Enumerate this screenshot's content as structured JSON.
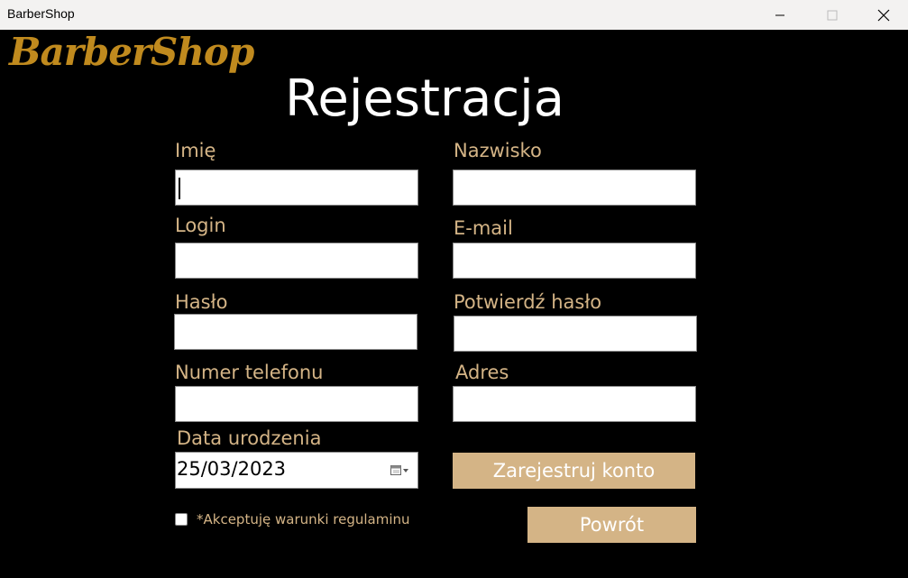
{
  "window": {
    "title": "BarberShop",
    "icons": {
      "minimize": "minimize-icon",
      "maximize": "maximize-icon",
      "close": "close-icon"
    }
  },
  "logo": "BarberShop",
  "page_title": "Rejestracja",
  "form": {
    "imie_label": "Imię",
    "nazwisko_label": "Nazwisko",
    "login_label": "Login",
    "email_label": "E-mail",
    "haslo_label": "Hasło",
    "potwierdz_label": "Potwierdź hasło",
    "telefon_label": "Numer telefonu",
    "adres_label": "Adres",
    "data_label": "Data urodzenia",
    "data_value": "25/03/2023",
    "checkbox_label": "*Akceptuję warunki regulaminu",
    "checkbox_checked": false
  },
  "buttons": {
    "register": "Zarejestruj konto",
    "back": "Powrót"
  },
  "colors": {
    "background": "#000000",
    "accent": "#d4b486",
    "logo": "#c08a1e",
    "title": "#ffffff"
  }
}
